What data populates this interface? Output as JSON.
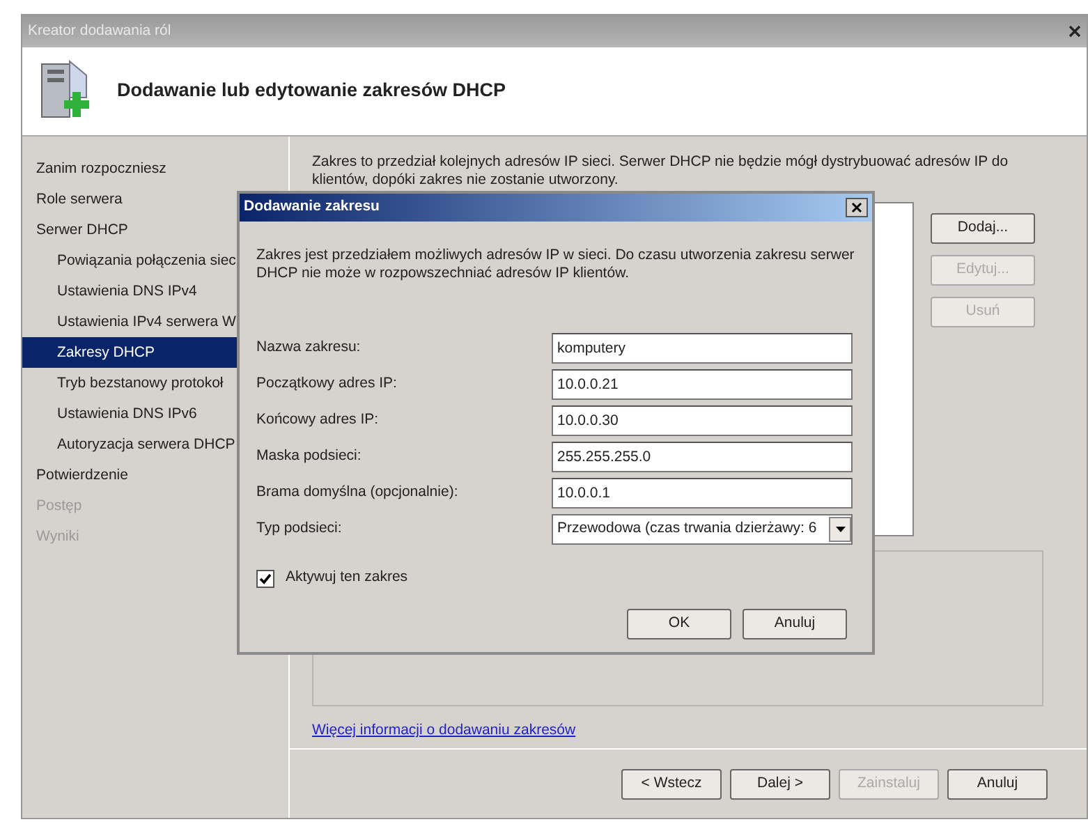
{
  "window": {
    "title": "Kreator dodawania ról"
  },
  "header": {
    "title": "Dodawanie lub edytowanie zakresów DHCP"
  },
  "nav": [
    {
      "label": "Zanim rozpoczniesz",
      "selected": false,
      "disabled": false
    },
    {
      "label": "Role serwera",
      "selected": false,
      "disabled": false
    },
    {
      "label": "Serwer DHCP",
      "selected": false,
      "disabled": false,
      "children": [
        {
          "label": "Powiązania połączenia siec",
          "selected": false,
          "disabled": false
        },
        {
          "label": "Ustawienia DNS IPv4",
          "selected": false,
          "disabled": false
        },
        {
          "label": "Ustawienia IPv4 serwera W",
          "selected": false,
          "disabled": false
        },
        {
          "label": "Zakresy DHCP",
          "selected": true,
          "disabled": false
        },
        {
          "label": "Tryb bezstanowy protokoł",
          "selected": false,
          "disabled": false
        },
        {
          "label": "Ustawienia DNS IPv6",
          "selected": false,
          "disabled": false
        },
        {
          "label": "Autoryzacja serwera DHCP",
          "selected": false,
          "disabled": false
        }
      ]
    },
    {
      "label": "Potwierdzenie",
      "selected": false,
      "disabled": false
    },
    {
      "label": "Postęp",
      "selected": false,
      "disabled": true
    },
    {
      "label": "Wyniki",
      "selected": false,
      "disabled": true
    }
  ],
  "content": {
    "description": "Zakres to przedział kolejnych adresów IP sieci. Serwer DHCP nie będzie mógł dystrybuować adresów IP do klientów, dopóki zakres nie zostanie utworzony.",
    "side_buttons": [
      {
        "label": "Dodaj...",
        "disabled": false
      },
      {
        "label": "Edytuj...",
        "disabled": true
      },
      {
        "label": "Usuń",
        "disabled": true
      }
    ],
    "link": "Więcej informacji o dodawaniu zakresów"
  },
  "footer_buttons": [
    {
      "label": "< Wstecz",
      "disabled": false
    },
    {
      "label": "Dalej >",
      "disabled": false
    },
    {
      "label": "Zainstaluj",
      "disabled": true
    },
    {
      "label": "Anuluj",
      "disabled": false
    }
  ],
  "dialog": {
    "title": "Dodawanie zakresu",
    "description": "Zakres jest przedziałem możliwych adresów IP w sieci. Do czasu utworzenia zakresu serwer DHCP nie może w rozpowszechniać adresów IP klientów.",
    "fields": [
      {
        "kind": "text",
        "label": "Nazwa zakresu:",
        "value": "komputery"
      },
      {
        "kind": "text",
        "label": "Początkowy adres IP:",
        "value": "10.0.0.21"
      },
      {
        "kind": "text",
        "label": "Końcowy adres IP:",
        "value": "10.0.0.30"
      },
      {
        "kind": "text",
        "label": "Maska podsieci:",
        "value": "255.255.255.0"
      },
      {
        "kind": "text",
        "label": "Brama domyślna (opcjonalnie):",
        "value": "10.0.0.1"
      },
      {
        "kind": "select",
        "label": "Typ podsieci:",
        "value": "Przewodowa (czas trwania dzierżawy: 6"
      }
    ],
    "checkbox": {
      "label": "Aktywuj ten zakres",
      "checked": true
    },
    "buttons": [
      {
        "label": "OK"
      },
      {
        "label": "Anuluj"
      }
    ]
  }
}
